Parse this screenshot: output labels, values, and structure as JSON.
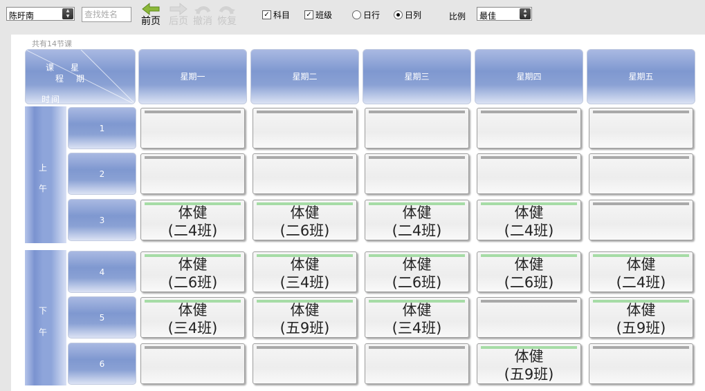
{
  "toolbar": {
    "teacher_select": "陈旴南",
    "search_placeholder": "查找姓名",
    "prev_label": "前页",
    "next_label": "后页",
    "undo_label": "撤消",
    "redo_label": "恢复",
    "subject_label": "科目",
    "subject_checked": true,
    "class_label": "班级",
    "class_checked": true,
    "day_row_label": "日行",
    "day_row_selected": false,
    "day_col_label": "日列",
    "day_col_selected": true,
    "ratio_label": "比例",
    "ratio_value": "最佳"
  },
  "schedule": {
    "lesson_count_text": "共有14节课",
    "corner": {
      "ke": "课",
      "xing": "星",
      "cheng": "程",
      "qi": "期",
      "shi": "时",
      "jian": "间"
    },
    "days": [
      "星期一",
      "星期二",
      "星期三",
      "星期四",
      "星期五"
    ],
    "sessions": [
      {
        "label_top": "上",
        "label_bottom": "午"
      },
      {
        "label_top": "下",
        "label_bottom": "午"
      }
    ],
    "periods": [
      "1",
      "2",
      "3",
      "4",
      "5",
      "6"
    ],
    "cells": [
      [
        {
          "subject": "",
          "class": ""
        },
        {
          "subject": "",
          "class": ""
        },
        {
          "subject": "",
          "class": ""
        },
        {
          "subject": "",
          "class": ""
        },
        {
          "subject": "",
          "class": ""
        }
      ],
      [
        {
          "subject": "",
          "class": ""
        },
        {
          "subject": "",
          "class": ""
        },
        {
          "subject": "",
          "class": ""
        },
        {
          "subject": "",
          "class": ""
        },
        {
          "subject": "",
          "class": ""
        }
      ],
      [
        {
          "subject": "体健",
          "class": "(二4班)"
        },
        {
          "subject": "体健",
          "class": "(二6班)"
        },
        {
          "subject": "体健",
          "class": "(二4班)"
        },
        {
          "subject": "体健",
          "class": "(二4班)"
        },
        {
          "subject": "",
          "class": ""
        }
      ],
      [
        {
          "subject": "体健",
          "class": "(二6班)"
        },
        {
          "subject": "体健",
          "class": "(三4班)"
        },
        {
          "subject": "体健",
          "class": "(二6班)"
        },
        {
          "subject": "体健",
          "class": "(二6班)"
        },
        {
          "subject": "体健",
          "class": "(二4班)"
        }
      ],
      [
        {
          "subject": "体健",
          "class": "(三4班)"
        },
        {
          "subject": "体健",
          "class": "(五9班)"
        },
        {
          "subject": "体健",
          "class": "(三4班)"
        },
        {
          "subject": "",
          "class": ""
        },
        {
          "subject": "体健",
          "class": "(五9班)"
        }
      ],
      [
        {
          "subject": "",
          "class": ""
        },
        {
          "subject": "",
          "class": ""
        },
        {
          "subject": "",
          "class": ""
        },
        {
          "subject": "体健",
          "class": "(五9班)"
        },
        {
          "subject": "",
          "class": ""
        }
      ]
    ]
  },
  "colors": {
    "header_blue": "#7f98d0",
    "filled_bar": "#a6dca6",
    "empty_bar": "#a9a9a9",
    "prev_arrow": "#8cb83a"
  }
}
